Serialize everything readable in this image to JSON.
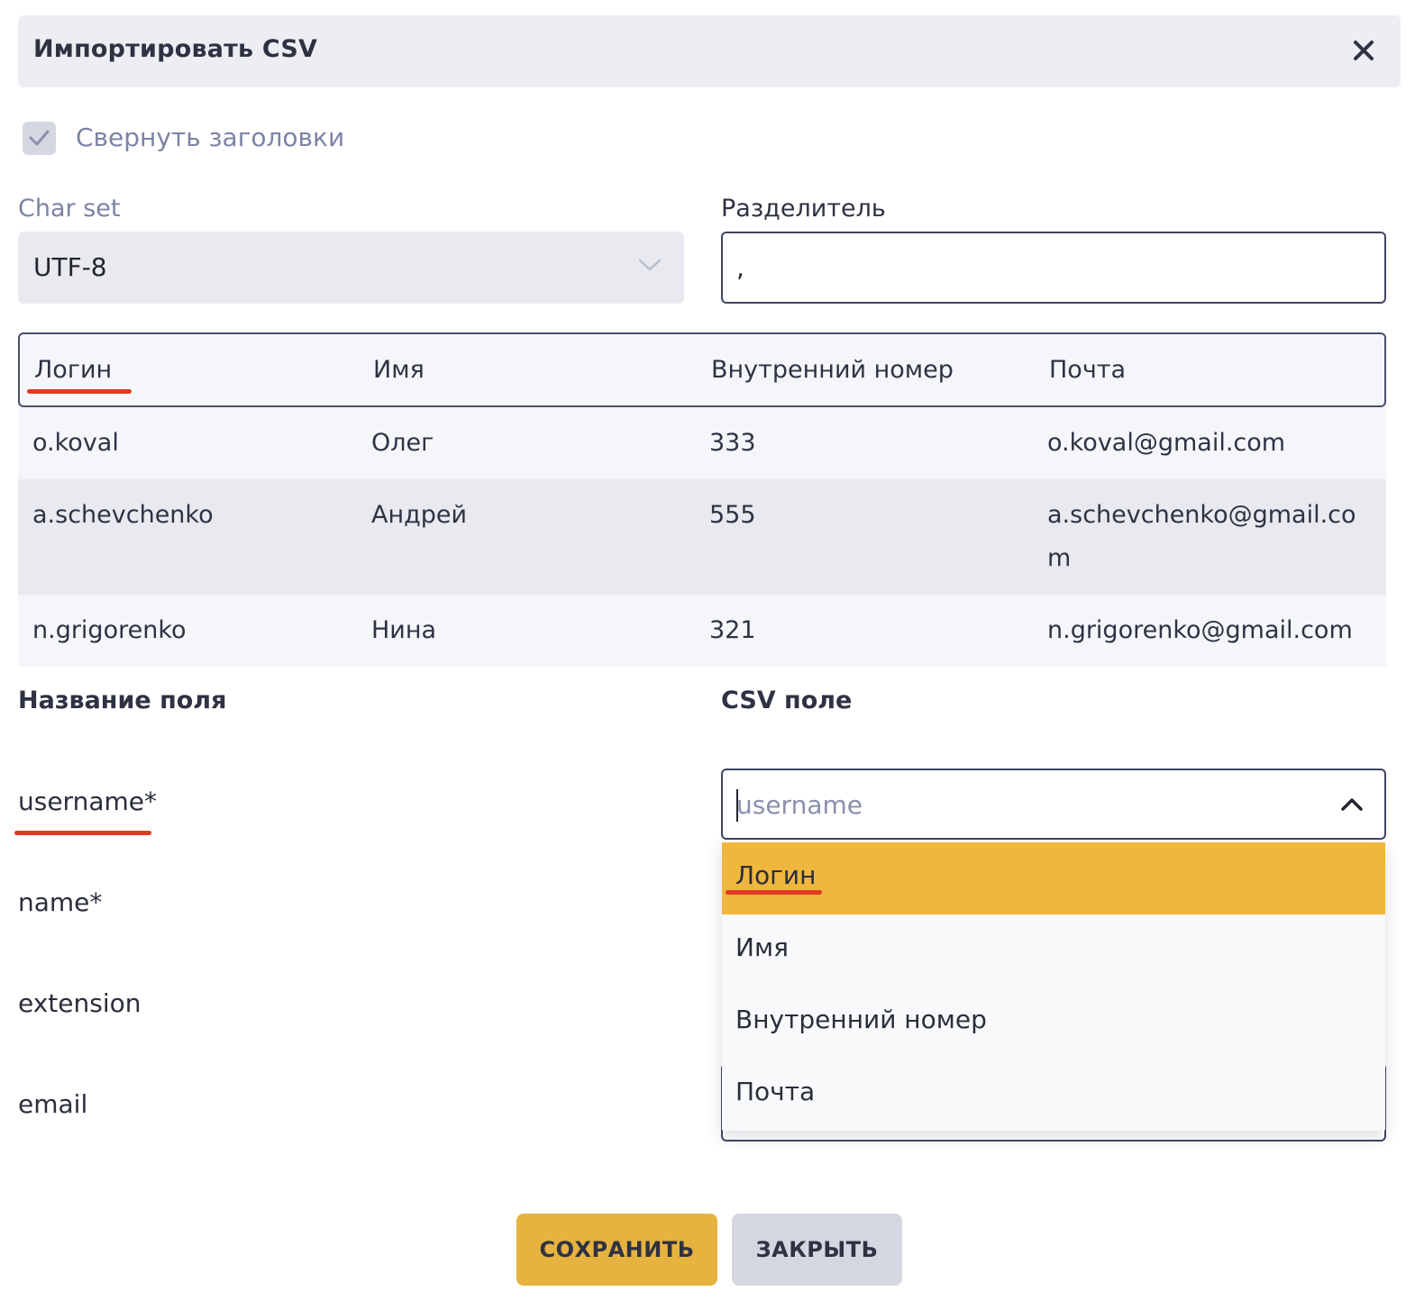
{
  "dialog": {
    "title": "Импортировать CSV",
    "close_icon": "close-icon"
  },
  "collapse_headers": {
    "label": "Свернуть заголовки",
    "checked": true
  },
  "charset": {
    "label": "Char set",
    "value": "UTF-8"
  },
  "delimiter": {
    "label": "Разделитель",
    "value": ","
  },
  "preview_table": {
    "headers": [
      "Логин",
      "Имя",
      "Внутренний номер",
      "Почта"
    ],
    "rows": [
      [
        "o.koval",
        "Олег",
        "333",
        "o.koval@gmail.com"
      ],
      [
        "a.schevchenko",
        "Андрей",
        "555",
        "a.schevchenko@gmail.com"
      ],
      [
        "n.grigorenko",
        "Нина",
        "321",
        "n.grigorenko@gmail.com"
      ]
    ]
  },
  "mapping": {
    "field_name_header": "Название поля",
    "csv_field_header": "CSV поле",
    "fields": [
      "username*",
      "name*",
      "extension",
      "email"
    ],
    "csv_select_placeholder": "username",
    "dropdown_options": [
      "Логин",
      "Имя",
      "Внутренний номер",
      "Почта"
    ],
    "highlighted_option": "Логин"
  },
  "buttons": {
    "save": "СОХРАНИТЬ",
    "close": "ЗАКРЫТЬ"
  },
  "colors": {
    "accent": "#efb73e",
    "annotation_underline": "#e23a22"
  }
}
